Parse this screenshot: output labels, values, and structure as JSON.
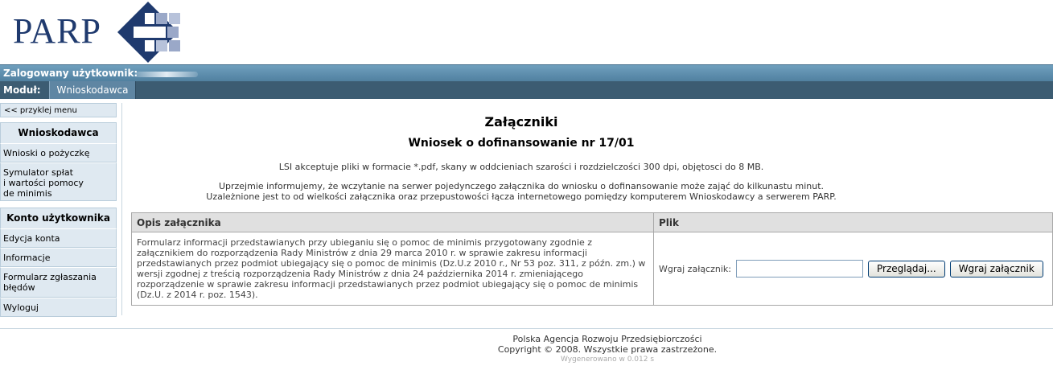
{
  "header": {
    "logo_text": "PARP",
    "logged_user_label": "Zalogowany użytkownik:",
    "module_label": "Moduł:",
    "module_tab": "Wnioskodawca"
  },
  "sidebar": {
    "unpin_label": "<< przyklej menu",
    "sections": [
      {
        "title": "Wnioskodawca",
        "items": [
          "Wnioski o pożyczkę",
          "Symulator spłat\ni wartości pomocy\nde minimis"
        ]
      },
      {
        "title": "Konto użytkownika",
        "items": [
          "Edycja konta",
          "Informacje",
          "Formularz zgłaszania błędów",
          "Wyloguj"
        ]
      }
    ]
  },
  "main": {
    "title": "Załączniki",
    "subtitle": "Wniosek o dofinansowanie nr 17/01",
    "info_formats": "LSI akceptuje pliki w formacie *.pdf, skany w oddcieniach szarości i rozdzielczości 300 dpi, objętosci do 8 MB.",
    "info_wait_1": "Uprzejmie informujemy, że wczytanie na serwer pojedynczego załącznika do wniosku o dofinansowanie może zająć do kilkunastu minut.",
    "info_wait_2": "Uzależnione jest to od wielkości załącznika oraz przepustowości łącza internetowego pomiędzy komputerem Wnioskodawcy a serwerem PARP.",
    "table": {
      "col_desc": "Opis załącznika",
      "col_file": "Plik",
      "rows": [
        {
          "description": "Formularz informacji przedstawianych przy ubieganiu się o pomoc de minimis przygotowany zgodnie z załącznikiem do rozporządzenia Rady Ministrów z dnia 29 marca 2010 r. w sprawie zakresu informacji przedstawianych przez podmiot ubiegający się o pomoc de minimis (Dz.U.z 2010 r., Nr 53 poz. 311, z późn. zm.) w wersji zgodnej z treścią rozporządzenia Rady Ministrów z dnia 24 października 2014 r. zmieniającego rozporządzenie w sprawie zakresu informacji przedstawianych przez podmiot ubiegający się o pomoc de minimis (Dz.U. z 2014 r. poz. 1543).",
          "upload_label": "Wgraj załącznik:",
          "browse_button": "Przeglądaj...",
          "upload_button": "Wgraj załącznik"
        }
      ]
    }
  },
  "footer": {
    "line1": "Polska Agencja Rozwoju Przedsiębiorczości",
    "line2": "Copyright © 2008. Wszystkie prawa zastrzeżone.",
    "generated": "Wygenerowano w 0.012 s"
  },
  "colors": {
    "brand": "#1f3a6e",
    "userbar": "#5a8aab",
    "modbar": "#3c5c72",
    "sidebar_bg": "#dfe9f1"
  }
}
